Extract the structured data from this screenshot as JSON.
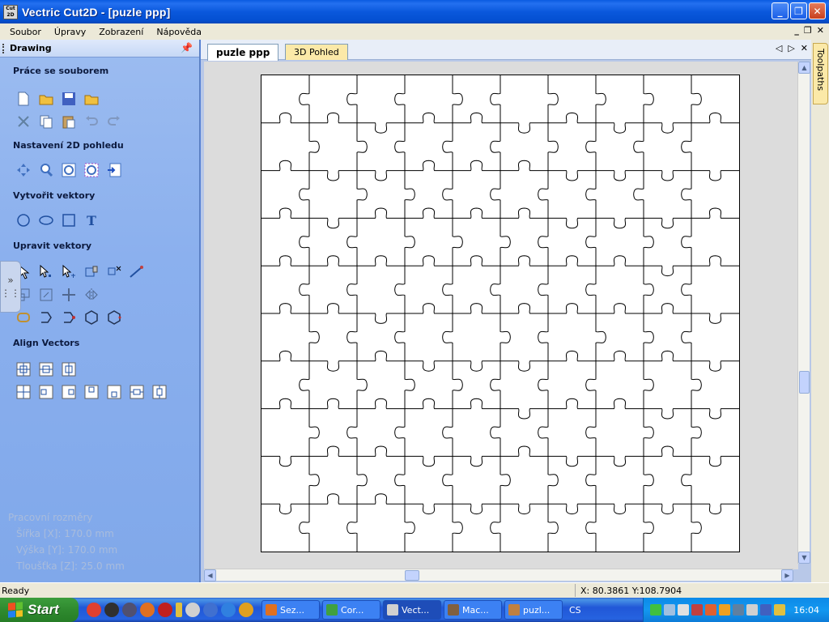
{
  "window": {
    "title": "Vectric Cut2D - [puzle   ppp]",
    "icon_label": "Cut 2D"
  },
  "menubar": {
    "items": [
      "Soubor",
      "Úpravy",
      "Zobrazení",
      "Nápověda"
    ]
  },
  "panel": {
    "title": "Drawing",
    "sections": {
      "file": "Práce se souborem",
      "view": "Nastavení 2D pohledu",
      "create": "Vytvořit vektory",
      "edit": "Upravit vektory",
      "align": "Align Vectors"
    },
    "dims": {
      "title": "Pracovní rozměry",
      "width": "Šířka    [X]: 170.0 mm",
      "height": "Výška    [Y]: 170.0 mm",
      "thickness": "Tloušťka [Z]: 25.0 mm"
    }
  },
  "tabs": [
    {
      "label": "puzle   ppp",
      "active": true
    },
    {
      "label": "3D Pohled",
      "active": false
    }
  ],
  "right_tab": {
    "label": "Toolpaths"
  },
  "status": {
    "left": "Ready",
    "coords": "X: 80.3861 Y:108.7904"
  },
  "taskbar": {
    "start": "Start",
    "tasks": [
      "Sez...",
      "Cor...",
      "Vect...",
      "Mac...",
      "puzl..."
    ],
    "lang": "CS",
    "clock": "16:04"
  },
  "puzzle": {
    "cols": 10,
    "rows": 10
  }
}
